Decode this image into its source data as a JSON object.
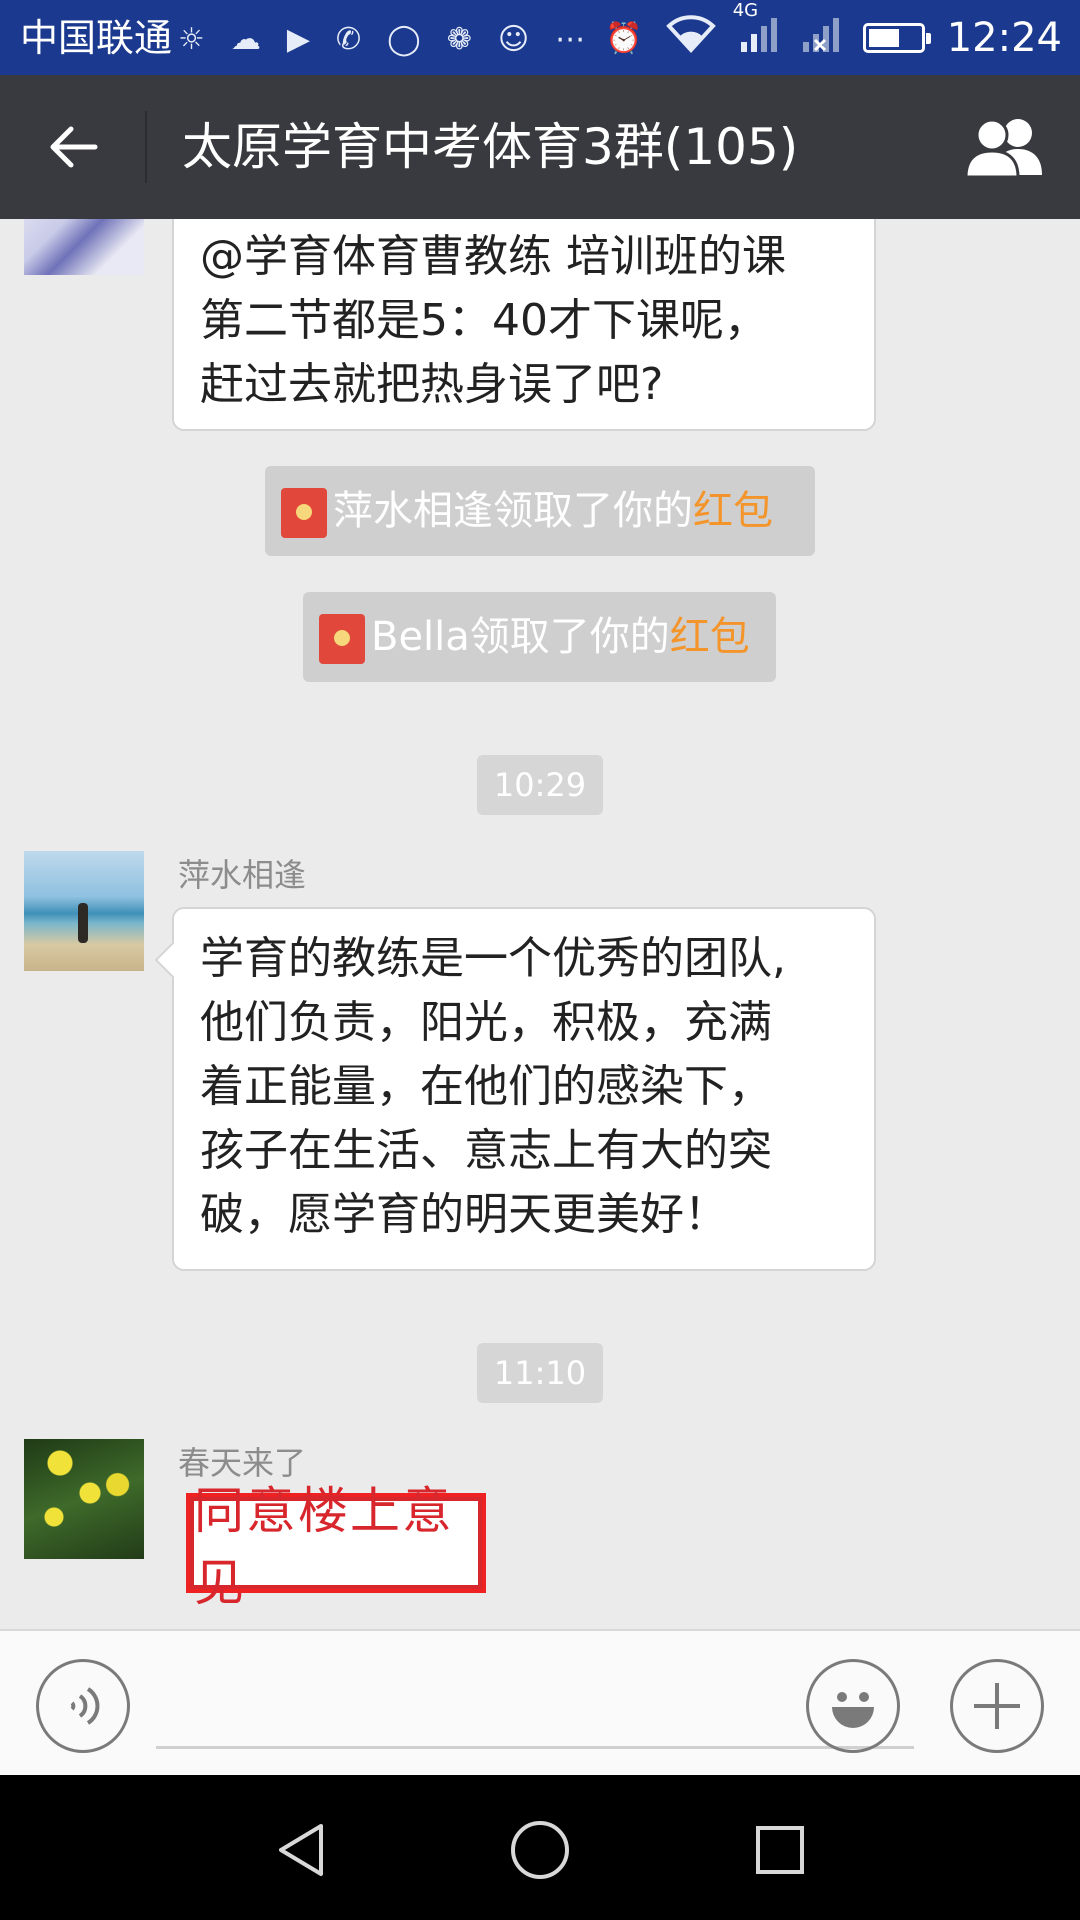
{
  "status_bar": {
    "carrier": "中国联通",
    "time": "12:24",
    "network": "4G",
    "battery_level": 0.6,
    "icons": [
      "weather-icon",
      "cloud-icon",
      "play-icon",
      "missed-call-icon",
      "chat-bubble-icon",
      "app-icon",
      "wechat-icon",
      "more-icon",
      "alarm-icon",
      "wifi-icon",
      "signal-icon",
      "signal-x-icon",
      "battery-icon"
    ]
  },
  "header": {
    "title": "太原学育中考体育3群(105)"
  },
  "messages": {
    "msg1_text_line1": "@学育体育曹教练 培训班的课",
    "msg1_text_line2": "第二节都是5：40才下课呢，",
    "msg1_text_line3": "赶过去就把热身误了吧?",
    "redpacket1_prefix": "萍水相逢领取了你的",
    "redpacket1_highlight": "红包",
    "redpacket2_prefix": "Bella领取了你的",
    "redpacket2_highlight": "红包",
    "time1": "10:29",
    "msg2_sender": "萍水相逢",
    "msg2_line1": "学育的教练是一个优秀的团队,",
    "msg2_line2": "他们负责，阳光，积极，充满",
    "msg2_line3": "着正能量，在他们的感染下，",
    "msg2_line4": "孩子在生活、意志上有大的突",
    "msg2_line5": "破，愿学育的明天更美好！",
    "time2": "11:10",
    "msg3_sender": "春天来了",
    "msg3_sticker_text": "同意楼上意见"
  },
  "input_bar": {
    "placeholder": ""
  },
  "colors": {
    "status_bar": "#1b3a8f",
    "title_bar": "#393a3f",
    "background": "#ebebeb",
    "highlight": "#f4952b",
    "red_packet": "#e1473a"
  }
}
